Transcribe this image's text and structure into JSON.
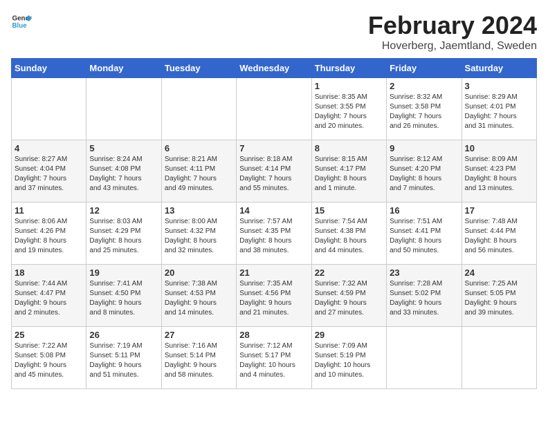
{
  "logo": {
    "line1": "General",
    "line2": "Blue"
  },
  "title": "February 2024",
  "subtitle": "Hoverberg, Jaemtland, Sweden",
  "days_of_week": [
    "Sunday",
    "Monday",
    "Tuesday",
    "Wednesday",
    "Thursday",
    "Friday",
    "Saturday"
  ],
  "weeks": [
    [
      {
        "day": "",
        "info": ""
      },
      {
        "day": "",
        "info": ""
      },
      {
        "day": "",
        "info": ""
      },
      {
        "day": "",
        "info": ""
      },
      {
        "day": "1",
        "info": "Sunrise: 8:35 AM\nSunset: 3:55 PM\nDaylight: 7 hours\nand 20 minutes."
      },
      {
        "day": "2",
        "info": "Sunrise: 8:32 AM\nSunset: 3:58 PM\nDaylight: 7 hours\nand 26 minutes."
      },
      {
        "day": "3",
        "info": "Sunrise: 8:29 AM\nSunset: 4:01 PM\nDaylight: 7 hours\nand 31 minutes."
      }
    ],
    [
      {
        "day": "4",
        "info": "Sunrise: 8:27 AM\nSunset: 4:04 PM\nDaylight: 7 hours\nand 37 minutes."
      },
      {
        "day": "5",
        "info": "Sunrise: 8:24 AM\nSunset: 4:08 PM\nDaylight: 7 hours\nand 43 minutes."
      },
      {
        "day": "6",
        "info": "Sunrise: 8:21 AM\nSunset: 4:11 PM\nDaylight: 7 hours\nand 49 minutes."
      },
      {
        "day": "7",
        "info": "Sunrise: 8:18 AM\nSunset: 4:14 PM\nDaylight: 7 hours\nand 55 minutes."
      },
      {
        "day": "8",
        "info": "Sunrise: 8:15 AM\nSunset: 4:17 PM\nDaylight: 8 hours\nand 1 minute."
      },
      {
        "day": "9",
        "info": "Sunrise: 8:12 AM\nSunset: 4:20 PM\nDaylight: 8 hours\nand 7 minutes."
      },
      {
        "day": "10",
        "info": "Sunrise: 8:09 AM\nSunset: 4:23 PM\nDaylight: 8 hours\nand 13 minutes."
      }
    ],
    [
      {
        "day": "11",
        "info": "Sunrise: 8:06 AM\nSunset: 4:26 PM\nDaylight: 8 hours\nand 19 minutes."
      },
      {
        "day": "12",
        "info": "Sunrise: 8:03 AM\nSunset: 4:29 PM\nDaylight: 8 hours\nand 25 minutes."
      },
      {
        "day": "13",
        "info": "Sunrise: 8:00 AM\nSunset: 4:32 PM\nDaylight: 8 hours\nand 32 minutes."
      },
      {
        "day": "14",
        "info": "Sunrise: 7:57 AM\nSunset: 4:35 PM\nDaylight: 8 hours\nand 38 minutes."
      },
      {
        "day": "15",
        "info": "Sunrise: 7:54 AM\nSunset: 4:38 PM\nDaylight: 8 hours\nand 44 minutes."
      },
      {
        "day": "16",
        "info": "Sunrise: 7:51 AM\nSunset: 4:41 PM\nDaylight: 8 hours\nand 50 minutes."
      },
      {
        "day": "17",
        "info": "Sunrise: 7:48 AM\nSunset: 4:44 PM\nDaylight: 8 hours\nand 56 minutes."
      }
    ],
    [
      {
        "day": "18",
        "info": "Sunrise: 7:44 AM\nSunset: 4:47 PM\nDaylight: 9 hours\nand 2 minutes."
      },
      {
        "day": "19",
        "info": "Sunrise: 7:41 AM\nSunset: 4:50 PM\nDaylight: 9 hours\nand 8 minutes."
      },
      {
        "day": "20",
        "info": "Sunrise: 7:38 AM\nSunset: 4:53 PM\nDaylight: 9 hours\nand 14 minutes."
      },
      {
        "day": "21",
        "info": "Sunrise: 7:35 AM\nSunset: 4:56 PM\nDaylight: 9 hours\nand 21 minutes."
      },
      {
        "day": "22",
        "info": "Sunrise: 7:32 AM\nSunset: 4:59 PM\nDaylight: 9 hours\nand 27 minutes."
      },
      {
        "day": "23",
        "info": "Sunrise: 7:28 AM\nSunset: 5:02 PM\nDaylight: 9 hours\nand 33 minutes."
      },
      {
        "day": "24",
        "info": "Sunrise: 7:25 AM\nSunset: 5:05 PM\nDaylight: 9 hours\nand 39 minutes."
      }
    ],
    [
      {
        "day": "25",
        "info": "Sunrise: 7:22 AM\nSunset: 5:08 PM\nDaylight: 9 hours\nand 45 minutes."
      },
      {
        "day": "26",
        "info": "Sunrise: 7:19 AM\nSunset: 5:11 PM\nDaylight: 9 hours\nand 51 minutes."
      },
      {
        "day": "27",
        "info": "Sunrise: 7:16 AM\nSunset: 5:14 PM\nDaylight: 9 hours\nand 58 minutes."
      },
      {
        "day": "28",
        "info": "Sunrise: 7:12 AM\nSunset: 5:17 PM\nDaylight: 10 hours\nand 4 minutes."
      },
      {
        "day": "29",
        "info": "Sunrise: 7:09 AM\nSunset: 5:19 PM\nDaylight: 10 hours\nand 10 minutes."
      },
      {
        "day": "",
        "info": ""
      },
      {
        "day": "",
        "info": ""
      }
    ]
  ]
}
